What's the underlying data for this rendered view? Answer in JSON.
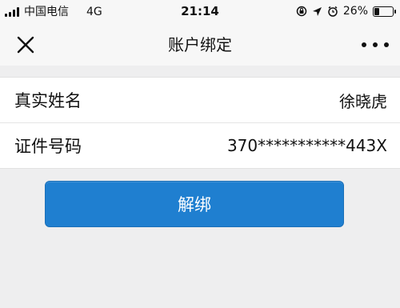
{
  "status_bar": {
    "carrier": "中国电信",
    "network": "4G",
    "time": "21:14",
    "battery": "26%",
    "battery_level": 0.26
  },
  "nav": {
    "title": "账户绑定",
    "close_icon": "close-icon",
    "more_icon": "more-icon"
  },
  "account": {
    "rows": [
      {
        "label": "真实姓名",
        "value": "徐晓虎"
      },
      {
        "label": "证件号码",
        "value": "370***********443X"
      }
    ]
  },
  "actions": {
    "unbind_label": "解绑"
  },
  "colors": {
    "accent": "#1f7fd0",
    "background": "#eeeeef"
  }
}
